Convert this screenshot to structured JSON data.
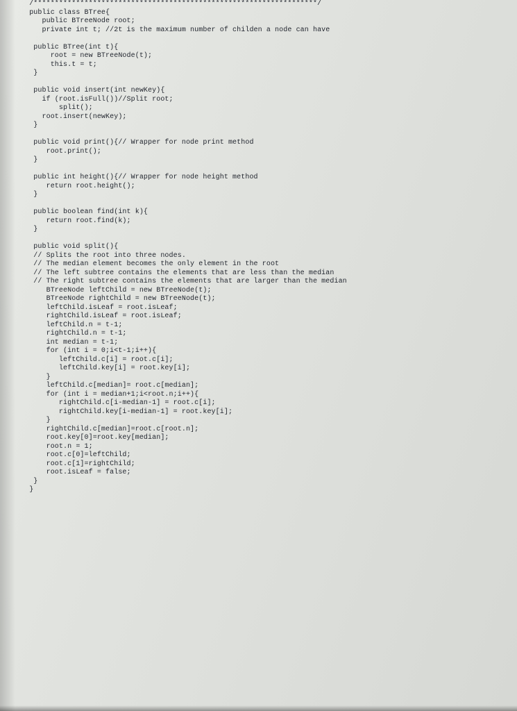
{
  "code_lines": [
    "  /*******************************************************************/",
    "  public class BTree{",
    "     public BTreeNode root;",
    "     private int t; //2t is the maximum number of childen a node can have",
    "",
    "   public BTree(int t){",
    "       root = new BTreeNode(t);",
    "       this.t = t;",
    "   }",
    "",
    "   public void insert(int newKey){",
    "     if (root.isFull())//Split root;",
    "         split();",
    "     root.insert(newKey);",
    "   }",
    "",
    "   public void print(){// Wrapper for node print method",
    "      root.print();",
    "   }",
    "",
    "   public int height(){// Wrapper for node height method",
    "      return root.height();",
    "   }",
    "",
    "   public boolean find(int k){",
    "      return root.find(k);",
    "   }",
    "",
    "   public void split(){",
    "   // Splits the root into three nodes.",
    "   // The median element becomes the only element in the root",
    "   // The left subtree contains the elements that are less than the median",
    "   // The right subtree contains the elements that are larger than the median",
    "      BTreeNode leftChild = new BTreeNode(t);",
    "      BTreeNode rightChild = new BTreeNode(t);",
    "      leftChild.isLeaf = root.isLeaf;",
    "      rightChild.isLeaf = root.isLeaf;",
    "      leftChild.n = t-1;",
    "      rightChild.n = t-1;",
    "      int median = t-1;",
    "      for (int i = 0;i<t-1;i++){",
    "         leftChild.c[i] = root.c[i];",
    "         leftChild.key[i] = root.key[i];",
    "      }",
    "      leftChild.c[median]= root.c[median];",
    "      for (int i = median+1;i<root.n;i++){",
    "         rightChild.c[i-median-1] = root.c[i];",
    "         rightChild.key[i-median-1] = root.key[i];",
    "      }",
    "      rightChild.c[median]=root.c[root.n];",
    "      root.key[0]=root.key[median];",
    "      root.n = 1;",
    "      root.c[0]=leftChild;",
    "      root.c[1]=rightChild;",
    "      root.isLeaf = false;",
    "   }",
    "  }"
  ]
}
